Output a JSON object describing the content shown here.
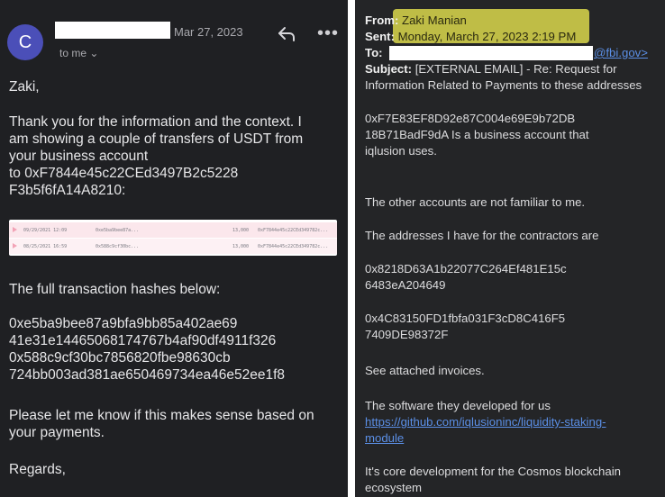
{
  "left": {
    "avatar_letter": "C",
    "date": "Mar 27, 2023",
    "to_me": "to me ⌄",
    "more_glyph": "•••",
    "greeting": "Zaki,",
    "para1_l1": "Thank you for the information and the context. I",
    "para1_l2": "am showing a couple of transfers of USDT from",
    "para1_l3": "your business account",
    "para1_l4": "to 0xF7844e45c22CEd3497B2c5228",
    "para1_l5": "F3b5f6fA14A8210:",
    "transactions": [
      {
        "date": "09/29/2021 12:09",
        "hash": "0xe5ba9bee87a...",
        "amount": "13,000",
        "to": "0xF7844e45c22CEd349782c..."
      },
      {
        "date": "08/25/2021 16:59",
        "hash": "0x588c9cf30bc...",
        "amount": "13,000",
        "to": "0xF7844e45c22CEd349782c..."
      }
    ],
    "hashes_intro": "The full transaction hashes below:",
    "hash1_l1": "0xe5ba9bee87a9bfa9bb85a402ae69",
    "hash1_l2": "41e31e14465068174767b4af90df4911f326",
    "hash2_l1": "0x588c9cf30bc7856820fbe98630cb",
    "hash2_l2": "724bb003ad381ae650469734ea46e52ee1f8",
    "please_l1": "Please let me know if this makes sense based on",
    "please_l2": "your payments.",
    "regards": "Regards,"
  },
  "right": {
    "from_label": "From:",
    "from_value": "Zaki Manian",
    "sent_label": "Sent:",
    "sent_value": "Monday, March 27, 2023 2:19 PM",
    "to_label": "To:",
    "to_domain": "@fbi.gov>",
    "subject_label": "Subject:",
    "subject_l1": "[EXTERNAL EMAIL] - Re: Request for",
    "subject_l2": "Information Related to Payments to these addresses",
    "addr_l1": "0xF7E83EF8D92e87C004e69E9b72DB",
    "addr_l2": "18B71BadF9dA Is a business account that",
    "addr_l3": "iqlusion uses.",
    "other": "The other accounts are not familiar to me.",
    "contractors": "The addresses I have for the contractors are",
    "c1_l1": "0x8218D63A1b22077C264Ef481E15c",
    "c1_l2": "6483eA204649",
    "c2_l1": "0x4C83150FD1fbfa031F3cD8C416F5",
    "c2_l2": "7409DE98372F",
    "invoices": "See attached invoices.",
    "software": "The software they developed for us",
    "link_l1": "https://github.com/iqlusioninc/liquidity-staking-",
    "link_l2": "module",
    "core_l1": "It's core development for the Cosmos blockchain",
    "core_l2": "ecosystem"
  }
}
